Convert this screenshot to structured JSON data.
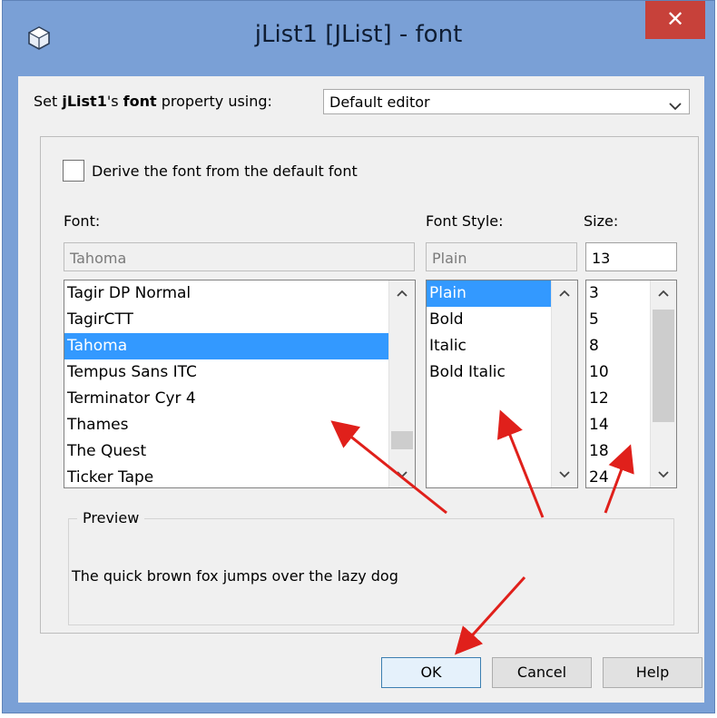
{
  "window": {
    "title": "jList1 [JList] - font",
    "close_label": "✕"
  },
  "editor": {
    "prefix": "Set ",
    "component": "jList1",
    "middle": "'s ",
    "property": "font",
    "suffix": " property using:",
    "selected": "Default editor"
  },
  "derive": {
    "label": "Derive the font from the default font",
    "checked": false
  },
  "font": {
    "label": "Font:",
    "value": "Tahoma",
    "items": [
      "Tagir DP Normal",
      "TagirCTT",
      "Tahoma",
      "Tempus Sans ITC",
      "Terminator Cyr 4",
      "Thames",
      "The Quest",
      "Ticker Tape"
    ],
    "selected_index": 2
  },
  "style": {
    "label": "Font Style:",
    "value": "Plain",
    "items": [
      "Plain",
      "Bold",
      "Italic",
      "Bold Italic"
    ],
    "selected_index": 0
  },
  "size": {
    "label": "Size:",
    "value": "13",
    "items": [
      "3",
      "5",
      "8",
      "10",
      "12",
      "14",
      "18",
      "24"
    ]
  },
  "preview": {
    "title": "Preview",
    "text": "The quick brown fox jumps over the lazy dog"
  },
  "buttons": {
    "ok": "OK",
    "cancel": "Cancel",
    "help": "Help"
  },
  "colors": {
    "titlebar": "#7aa0d6",
    "close": "#c7413a",
    "selection": "#3399ff",
    "annotation_arrow": "#e0201b"
  }
}
